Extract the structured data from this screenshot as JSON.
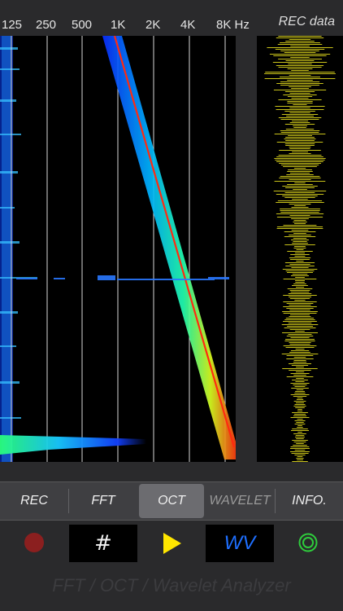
{
  "frequency_axis": {
    "labels": [
      "125",
      "250",
      "500",
      "1K",
      "2K",
      "4K",
      "8K Hz"
    ]
  },
  "waveform_panel": {
    "title": "REC data"
  },
  "tabs": [
    {
      "label": "REC",
      "state": "normal"
    },
    {
      "label": "FFT",
      "state": "normal"
    },
    {
      "label": "OCT",
      "state": "selected"
    },
    {
      "label": "WAVELET",
      "state": "disabled"
    },
    {
      "label": "INFO.",
      "state": "normal"
    }
  ],
  "controls": {
    "record_icon": "record-dot-icon",
    "grid_icon": "hash-icon",
    "grid_glyph": "#",
    "play_icon": "play-triangle-icon",
    "wv_label": "WV",
    "target_icon": "concentric-circle-icon"
  },
  "footer": {
    "text": "FFT / OCT / Wavelet Analyzer"
  },
  "colors": {
    "background": "#2a2a2c",
    "record": "#8b1f1f",
    "play": "#ffe600",
    "wv": "#1e6fff",
    "target": "#2ecc3c",
    "waveform": "#c9c21a",
    "tab_selected": "#6c6c70"
  }
}
